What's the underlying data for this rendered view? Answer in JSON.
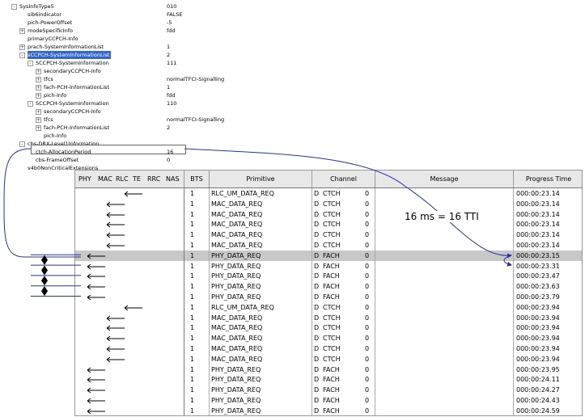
{
  "tree": [
    {
      "label": "SysInfoType5",
      "value": "010",
      "indent": 0,
      "toggle": "-"
    },
    {
      "label": "sib6indicator",
      "value": "FALSE",
      "indent": 1,
      "toggle": ""
    },
    {
      "label": "pich-PowerOffset",
      "value": "-5",
      "indent": 1,
      "toggle": ""
    },
    {
      "label": "modeSpecificInfo",
      "value": "fdd",
      "indent": 1,
      "toggle": "+"
    },
    {
      "label": "primaryCCPCH-Info",
      "value": "",
      "indent": 1,
      "toggle": ""
    },
    {
      "label": "prach-SystemInformationList",
      "value": "1",
      "indent": 1,
      "toggle": "+"
    },
    {
      "label": "sCCPCH-SystemInformationList",
      "value": "2",
      "indent": 1,
      "toggle": "-",
      "selected": true
    },
    {
      "label": "SCCPCH-SystemInformation",
      "value": "111",
      "indent": 2,
      "toggle": "-"
    },
    {
      "label": "secondaryCCPCH-Info",
      "value": "",
      "indent": 3,
      "toggle": "+"
    },
    {
      "label": "tfcs",
      "value": "normalTFCI-Signalling",
      "indent": 3,
      "toggle": "+"
    },
    {
      "label": "fach-PCH-InformationList",
      "value": "1",
      "indent": 3,
      "toggle": "+"
    },
    {
      "label": "pich-Info",
      "value": "fdd",
      "indent": 3,
      "toggle": "+"
    },
    {
      "label": "SCCPCH-SystemInformation",
      "value": "110",
      "indent": 2,
      "toggle": "-"
    },
    {
      "label": "secondaryCCPCH-Info",
      "value": "",
      "indent": 3,
      "toggle": "+"
    },
    {
      "label": "tfcs",
      "value": "normalTFCI-Signalling",
      "indent": 3,
      "toggle": "+"
    },
    {
      "label": "fach-PCH-InformationList",
      "value": "2",
      "indent": 3,
      "toggle": "+"
    },
    {
      "label": "pich-Info",
      "value": "",
      "indent": 3,
      "toggle": ""
    },
    {
      "label": "cbs-DRX-Level1Information",
      "value": "",
      "indent": 1,
      "toggle": "-"
    },
    {
      "label": "ctch-AllocationPeriod",
      "value": "16",
      "indent": 2,
      "toggle": ""
    },
    {
      "label": "cbs-FrameOffset",
      "value": "0",
      "indent": 2,
      "toggle": ""
    },
    {
      "label": "v4b0NonCriticalExtensions",
      "value": "",
      "indent": 1,
      "toggle": ""
    }
  ],
  "grid": {
    "headers": {
      "layers": [
        "PHY",
        "MAC",
        "RLC",
        "TE",
        "RRC",
        "NAS"
      ],
      "bts": "BTS",
      "primitive": "Primitive",
      "channel": "Channel",
      "message": "Message",
      "time": "Progress Time"
    },
    "rows": [
      {
        "bts": "1",
        "prim": "RLC_UM_DATA_REQ",
        "dir": "D",
        "ch": "CTCH",
        "n": "0",
        "time": "000:00:23.14",
        "layer": "RLC"
      },
      {
        "bts": "1",
        "prim": "MAC_DATA_REQ",
        "dir": "D",
        "ch": "CTCH",
        "n": "0",
        "time": "000:00:23.14",
        "layer": "MAC"
      },
      {
        "bts": "1",
        "prim": "MAC_DATA_REQ",
        "dir": "D",
        "ch": "CTCH",
        "n": "0",
        "time": "000:00:23.14",
        "layer": "MAC"
      },
      {
        "bts": "1",
        "prim": "MAC_DATA_REQ",
        "dir": "D",
        "ch": "CTCH",
        "n": "0",
        "time": "000:00:23.14",
        "layer": "MAC"
      },
      {
        "bts": "1",
        "prim": "MAC_DATA_REQ",
        "dir": "D",
        "ch": "CTCH",
        "n": "0",
        "time": "000:00:23.14",
        "layer": "MAC"
      },
      {
        "bts": "1",
        "prim": "MAC_DATA_REQ",
        "dir": "D",
        "ch": "CTCH",
        "n": "0",
        "time": "000:00:23.14",
        "layer": "MAC"
      },
      {
        "bts": "1",
        "prim": "PHY_DATA_REQ",
        "dir": "D",
        "ch": "FACH",
        "n": "0",
        "time": "000:00:23.15",
        "layer": "PHY",
        "hi": true
      },
      {
        "bts": "1",
        "prim": "PHY_DATA_REQ",
        "dir": "D",
        "ch": "FACH",
        "n": "0",
        "time": "000:00:23.31",
        "layer": "PHY"
      },
      {
        "bts": "1",
        "prim": "PHY_DATA_REQ",
        "dir": "D",
        "ch": "FACH",
        "n": "0",
        "time": "000:00:23.47",
        "layer": "PHY"
      },
      {
        "bts": "1",
        "prim": "PHY_DATA_REQ",
        "dir": "D",
        "ch": "FACH",
        "n": "0",
        "time": "000:00:23.63",
        "layer": "PHY"
      },
      {
        "bts": "1",
        "prim": "PHY_DATA_REQ",
        "dir": "D",
        "ch": "FACH",
        "n": "0",
        "time": "000:00:23.79",
        "layer": "PHY"
      },
      {
        "bts": "1",
        "prim": "RLC_UM_DATA_REQ",
        "dir": "D",
        "ch": "CTCH",
        "n": "0",
        "time": "000:00:23.94",
        "layer": "RLC"
      },
      {
        "bts": "1",
        "prim": "MAC_DATA_REQ",
        "dir": "D",
        "ch": "CTCH",
        "n": "0",
        "time": "000:00:23.94",
        "layer": "MAC"
      },
      {
        "bts": "1",
        "prim": "MAC_DATA_REQ",
        "dir": "D",
        "ch": "CTCH",
        "n": "0",
        "time": "000:00:23.94",
        "layer": "MAC"
      },
      {
        "bts": "1",
        "prim": "MAC_DATA_REQ",
        "dir": "D",
        "ch": "CTCH",
        "n": "0",
        "time": "000:00:23.94",
        "layer": "MAC"
      },
      {
        "bts": "1",
        "prim": "MAC_DATA_REQ",
        "dir": "D",
        "ch": "CTCH",
        "n": "0",
        "time": "000:00:23.94",
        "layer": "MAC"
      },
      {
        "bts": "1",
        "prim": "MAC_DATA_REQ",
        "dir": "D",
        "ch": "CTCH",
        "n": "0",
        "time": "000:00:23.94",
        "layer": "MAC"
      },
      {
        "bts": "1",
        "prim": "PHY_DATA_REQ",
        "dir": "D",
        "ch": "FACH",
        "n": "0",
        "time": "000:00:23.95",
        "layer": "PHY"
      },
      {
        "bts": "1",
        "prim": "PHY_DATA_REQ",
        "dir": "D",
        "ch": "FACH",
        "n": "0",
        "time": "000:00:24.11",
        "layer": "PHY"
      },
      {
        "bts": "1",
        "prim": "PHY_DATA_REQ",
        "dir": "D",
        "ch": "FACH",
        "n": "0",
        "time": "000:00:24.27",
        "layer": "PHY"
      },
      {
        "bts": "1",
        "prim": "PHY_DATA_REQ",
        "dir": "D",
        "ch": "FACH",
        "n": "0",
        "time": "000:00:24.43",
        "layer": "PHY"
      },
      {
        "bts": "1",
        "prim": "PHY_DATA_REQ",
        "dir": "D",
        "ch": "FACH",
        "n": "0",
        "time": "000:00:24.59",
        "layer": "PHY"
      }
    ]
  },
  "annotation": {
    "note": "16 ms = 16 TTI",
    "color": "#2233aa"
  },
  "colors": {
    "selected": "#3366cc",
    "highlight_row": "#c8c8c8"
  }
}
